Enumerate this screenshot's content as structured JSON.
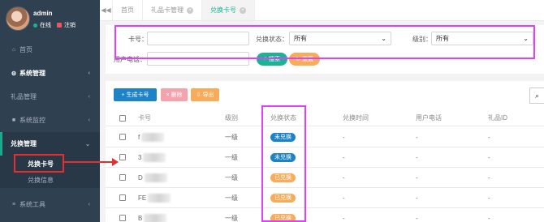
{
  "profile": {
    "name": "admin",
    "status": "在线",
    "logout": "注销"
  },
  "sidebar": {
    "items": [
      {
        "icon": "home-icon",
        "glyph": "⌂",
        "label": "首页"
      },
      {
        "icon": "gear-icon",
        "glyph": "⚙",
        "label": "系统管理"
      },
      {
        "icon": "none",
        "glyph": "",
        "label": "礼品管理"
      },
      {
        "icon": "video-icon",
        "glyph": "■",
        "label": "系统监控"
      },
      {
        "icon": "none",
        "glyph": "",
        "label": "兑换管理"
      },
      {
        "icon": "list-icon",
        "glyph": "≡",
        "label": "系统工具"
      }
    ],
    "sub_items": [
      {
        "label": "兑换卡号"
      },
      {
        "label": "兑换信息"
      }
    ]
  },
  "tabs": {
    "prev_icon": "double-chevron-left-icon",
    "prev_glyph": "◀◀",
    "items": [
      {
        "label": "首页"
      },
      {
        "label": "礼品卡管理"
      },
      {
        "label": "兑换卡号"
      }
    ]
  },
  "search": {
    "card_label": "卡号：",
    "status_label": "兑换状态：",
    "status_value": "所有",
    "level_label": "级别：",
    "level_value": "所有",
    "phone_label": "用户电话：",
    "search_button": "搜索",
    "reset_button": "重置"
  },
  "toolbar": {
    "create_button": "生成卡号",
    "delete_button": "删除",
    "export_button": "导出"
  },
  "table": {
    "columns": [
      "卡号",
      "级别",
      "兑换状态",
      "兑换时间",
      "用户电话",
      "礼品ID"
    ],
    "rows": [
      {
        "card": "f",
        "level": "一级",
        "status": "未兑换",
        "time": "-",
        "phone": "-",
        "gift": "-"
      },
      {
        "card": "3",
        "level": "一级",
        "status": "未兑换",
        "time": "-",
        "phone": "-",
        "gift": "-"
      },
      {
        "card": "D",
        "level": "一级",
        "status": "已兑换",
        "time": "-",
        "phone": "-",
        "gift": "-"
      },
      {
        "card": "FE",
        "level": "一级",
        "status": "已兑换",
        "time": "-",
        "phone": "-",
        "gift": "-"
      },
      {
        "card": "B",
        "level": "一级",
        "status": "已兑换",
        "time": "-",
        "phone": "-",
        "gift": "-"
      }
    ]
  },
  "colors": {
    "unredeemed": "#1c84c6",
    "redeemed": "#f8ac59",
    "primary": "#1ab394",
    "create": "#1c84c6",
    "delete": "#ed5565",
    "export": "#f8ac59",
    "sidebar": "#2f4050"
  }
}
